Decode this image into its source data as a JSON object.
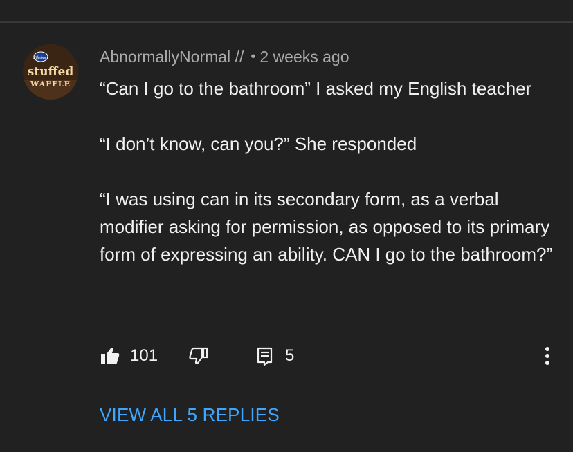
{
  "comment": {
    "avatar": {
      "icon": "stuffed-waffle-avatar",
      "brand_small": "Pillsbury",
      "brand_line1": "stuffed",
      "brand_line2": "WAFFLE"
    },
    "author": "AbnormallyNormal //",
    "separator": "•",
    "timestamp": "2 weeks ago",
    "paragraphs": [
      "“Can I go to the bathroom” I asked my English teacher",
      "“I don’t know, can you?” She responded",
      "“I was using can in its secondary form, as a verbal modifier asking for permission, as opposed to its primary form of expressing an ability. CAN I go to the bathroom?”"
    ],
    "actions": {
      "like_icon": "thumbs-up-icon",
      "like_count": "101",
      "dislike_icon": "thumbs-down-icon",
      "reply_icon": "reply-icon",
      "reply_count": "5",
      "more_icon": "more-vertical-icon"
    },
    "view_replies_label": "VIEW ALL 5 REPLIES"
  },
  "colors": {
    "background": "#212121",
    "text_primary": "#f1f1f1",
    "text_secondary": "#aaaaaa",
    "link_blue": "#3ea6ff"
  }
}
